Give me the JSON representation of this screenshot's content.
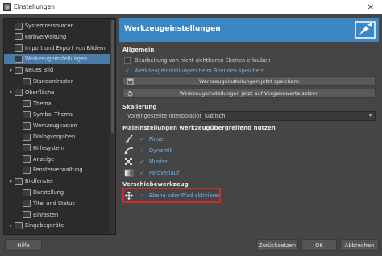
{
  "window": {
    "title": "Einstellungen",
    "close_glyph": "✕"
  },
  "sidebar": {
    "items": [
      {
        "label": "Systemressourcen",
        "icon": "memory-icon",
        "expander": ""
      },
      {
        "label": "Farbverwaltung",
        "icon": "color-management-icon",
        "expander": ""
      },
      {
        "label": "Import und Export von Bildern",
        "icon": "import-export-icon",
        "expander": ""
      },
      {
        "label": "Werkzeugeinstellungen",
        "icon": "tool-options-icon",
        "expander": "",
        "selected": true
      },
      {
        "label": "Neues Bild",
        "icon": "new-image-icon",
        "expander": "▾"
      },
      {
        "label": "Standardraster",
        "icon": "grid-icon",
        "expander": ""
      },
      {
        "label": "Oberfläche",
        "icon": "interface-icon",
        "expander": "▾"
      },
      {
        "label": "Thema",
        "icon": "theme-icon",
        "expander": ""
      },
      {
        "label": "Symbol-Thema",
        "icon": "icon-theme-icon",
        "expander": ""
      },
      {
        "label": "Werkzeugkasten",
        "icon": "toolbox-icon",
        "expander": ""
      },
      {
        "label": "Dialogvorgaben",
        "icon": "dialog-defaults-icon",
        "expander": ""
      },
      {
        "label": "Hilfesystem",
        "icon": "help-system-icon",
        "expander": ""
      },
      {
        "label": "Anzeige",
        "icon": "display-icon",
        "expander": ""
      },
      {
        "label": "Fensterverwaltung",
        "icon": "window-management-icon",
        "expander": ""
      },
      {
        "label": "Bildfenster",
        "icon": "image-window-icon",
        "expander": "▾"
      },
      {
        "label": "Darstellung",
        "icon": "appearance-icon",
        "expander": ""
      },
      {
        "label": "Titel und Status",
        "icon": "title-status-icon",
        "expander": ""
      },
      {
        "label": "Einrasten",
        "icon": "snapping-icon",
        "expander": ""
      },
      {
        "label": "Eingabegeräte",
        "icon": "input-devices-icon",
        "expander": "▾"
      }
    ]
  },
  "main": {
    "header_title": "Werkzeugeinstellungen",
    "allgemein": {
      "heading": "Allgemein",
      "opt1": "Bearbeitung von nicht-sichtbaren Ebenen erlauben",
      "opt1_checked": false,
      "opt2": "Werkzeugeinstellungen beim Beenden speichern",
      "opt2_checked": true,
      "btn_save": "Werkzeugeinstellungen jetzt speichern",
      "btn_reset": "Werkzeugeinstellungen jetzt auf Vorgabewerte setzen"
    },
    "skalierung": {
      "heading": "Skalierung",
      "interp_label": "Voreingestellte Interpolationsart:",
      "interp_value": "Kubisch"
    },
    "paint": {
      "heading": "Maleinstellungen werkzeugübergreifend nutzen",
      "items": [
        {
          "label": "Pinsel",
          "icon": "brush-icon",
          "checked": true
        },
        {
          "label": "Dynamik",
          "icon": "dynamics-icon",
          "checked": true
        },
        {
          "label": "Muster",
          "icon": "pattern-icon",
          "checked": true
        },
        {
          "label": "Farbverlauf",
          "icon": "gradient-icon",
          "checked": true
        }
      ]
    },
    "move": {
      "heading": "Verschiebewerkzeug",
      "label": "Ebene oder Pfad aktivieren",
      "icon": "move-tool-icon",
      "checked": true
    }
  },
  "footer": {
    "help": "Hilfe",
    "reset": "Zurücksetzen",
    "ok": "OK",
    "cancel": "Abbrechen"
  },
  "colors": {
    "accent": "#3a87c4",
    "selection": "#4a7aa8",
    "highlight_border": "#d8272c",
    "check_blue": "#5aa6e6"
  }
}
